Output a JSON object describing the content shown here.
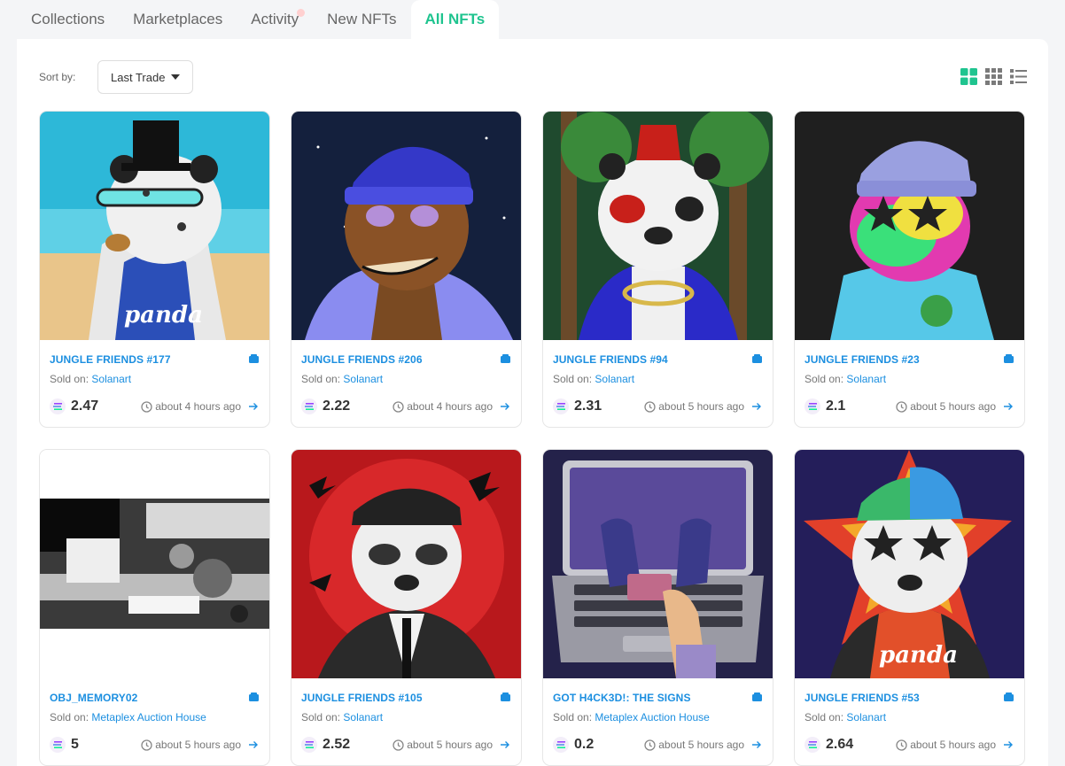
{
  "tabs": [
    {
      "label": "Collections",
      "active": false
    },
    {
      "label": "Marketplaces",
      "active": false
    },
    {
      "label": "Activity",
      "active": false,
      "notification_dot": true
    },
    {
      "label": "New NFTs",
      "active": false
    },
    {
      "label": "All NFTs",
      "active": true
    }
  ],
  "toolbar": {
    "sort_label": "Sort by:",
    "sort_value": "Last Trade",
    "view_modes": [
      "grid-large-icon",
      "grid-small-icon",
      "list-icon"
    ],
    "active_view": "grid-large-icon"
  },
  "sold_prefix": "Sold on:",
  "colors": {
    "accent": "#1fc48f",
    "link": "#1c8fe0"
  },
  "nfts": [
    {
      "name": "JUNGLE FRIENDS #177",
      "market": "Solanart",
      "price": "2.47",
      "time": "about 4 hours ago"
    },
    {
      "name": "JUNGLE FRIENDS #206",
      "market": "Solanart",
      "price": "2.22",
      "time": "about 4 hours ago"
    },
    {
      "name": "JUNGLE FRIENDS #94",
      "market": "Solanart",
      "price": "2.31",
      "time": "about 5 hours ago"
    },
    {
      "name": "JUNGLE FRIENDS #23",
      "market": "Solanart",
      "price": "2.1",
      "time": "about 5 hours ago"
    },
    {
      "name": "OBJ_MEMORY02",
      "market": "Metaplex Auction House",
      "price": "5",
      "time": "about 5 hours ago"
    },
    {
      "name": "JUNGLE FRIENDS #105",
      "market": "Solanart",
      "price": "2.52",
      "time": "about 5 hours ago"
    },
    {
      "name": "GOT H4CK3D!: THE SIGNS",
      "market": "Metaplex Auction House",
      "price": "0.2",
      "time": "about 5 hours ago"
    },
    {
      "name": "JUNGLE FRIENDS #53",
      "market": "Solanart",
      "price": "2.64",
      "time": "about 5 hours ago"
    }
  ],
  "image_text": {
    "jersey_1": "panda",
    "jersey_8": "panda"
  }
}
